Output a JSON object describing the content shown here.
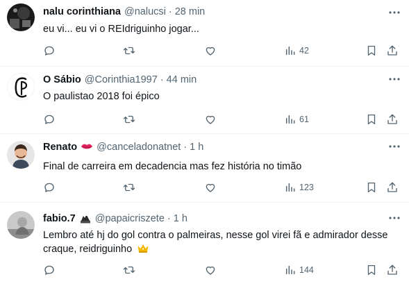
{
  "tweets": [
    {
      "name": "nalu corinthiana",
      "handle": "@nalucsi",
      "dot": "·",
      "time": "28 min",
      "text": "eu vi... eu vi o REIdriguinho jogar...",
      "views": "42",
      "avatar": "dark-photo-avatar"
    },
    {
      "name": "O Sábio",
      "handle": "@Corinthia1997",
      "dot": "·",
      "time": "44 min",
      "text": "O paulistao 2018 foi épico",
      "views": "61",
      "avatar": "corinthians-logo-avatar"
    },
    {
      "name": "Renato",
      "emoji": "lips-icon",
      "handle": "@canceladonatnet",
      "dot": "·",
      "time": "1 h",
      "text": "Final de carreira em decadencia mas fez história no timão",
      "views": "123",
      "avatar": "cartoon-avatar"
    },
    {
      "name": "fabio.7",
      "emoji": "flag-emoji-icon",
      "handle": "@papaicriszete",
      "dot": "·",
      "time": "1 h",
      "text": "Lembro até hj do gol contra o palmeiras, nesse gol virei fã e admirador desse craque, reidriguinho",
      "trailing_emoji": "crown-icon",
      "views": "144",
      "avatar": "gray-photo-avatar"
    }
  ],
  "colors": {
    "text": "#0f1419",
    "secondary": "#536471",
    "divider": "#eff3f4",
    "lips": "#e0245e",
    "crown": "#f5b800"
  }
}
